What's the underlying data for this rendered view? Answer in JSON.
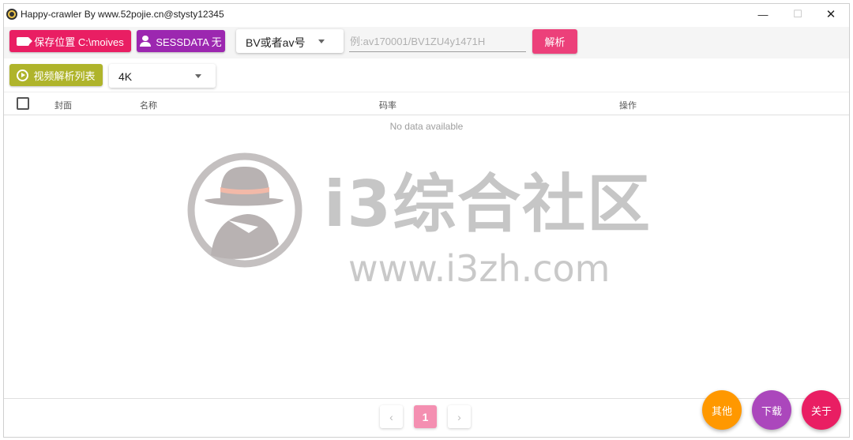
{
  "window": {
    "title": "Happy-crawler By www.52pojie.cn@stysty12345",
    "minimize_glyph": "—",
    "maximize_glyph": "☐",
    "close_glyph": "✕"
  },
  "toolbar": {
    "save_location_label": "保存位置 C:\\moives",
    "sessdata_label": "SESSDATA 无",
    "id_type_selected": "BV或者av号",
    "id_input_placeholder": "例:av170001/BV1ZU4y1471H",
    "id_input_value": "",
    "parse_label": "解析"
  },
  "toolbar2": {
    "video_list_label": "视频解析列表",
    "quality_selected": "4K"
  },
  "table": {
    "columns": [
      "封面",
      "名称",
      "码率",
      "操作"
    ],
    "rows": [],
    "empty_text": "No data available"
  },
  "watermark": {
    "brand_text": "i3综合社区",
    "url_text": "www.i3zh.com"
  },
  "pagination": {
    "prev_glyph": "‹",
    "current_page": "1",
    "next_glyph": "›"
  },
  "fab": {
    "other_label": "其他",
    "download_label": "下载",
    "about_label": "关于"
  },
  "colors": {
    "save_button": "#e91e63",
    "sessdata_button": "#9c27b0",
    "parse_button": "#ec407a",
    "video_list_button": "#afb42b",
    "page_current": "#f48fb1",
    "fab_other": "#ff9800",
    "fab_download": "#ab47bc",
    "fab_about": "#e91e63"
  },
  "icons": {
    "app": "app-logo-icon",
    "save": "label-tag-icon",
    "sessdata": "person-icon",
    "video_list": "play-circle-icon",
    "dropdown": "caret-down-icon"
  }
}
